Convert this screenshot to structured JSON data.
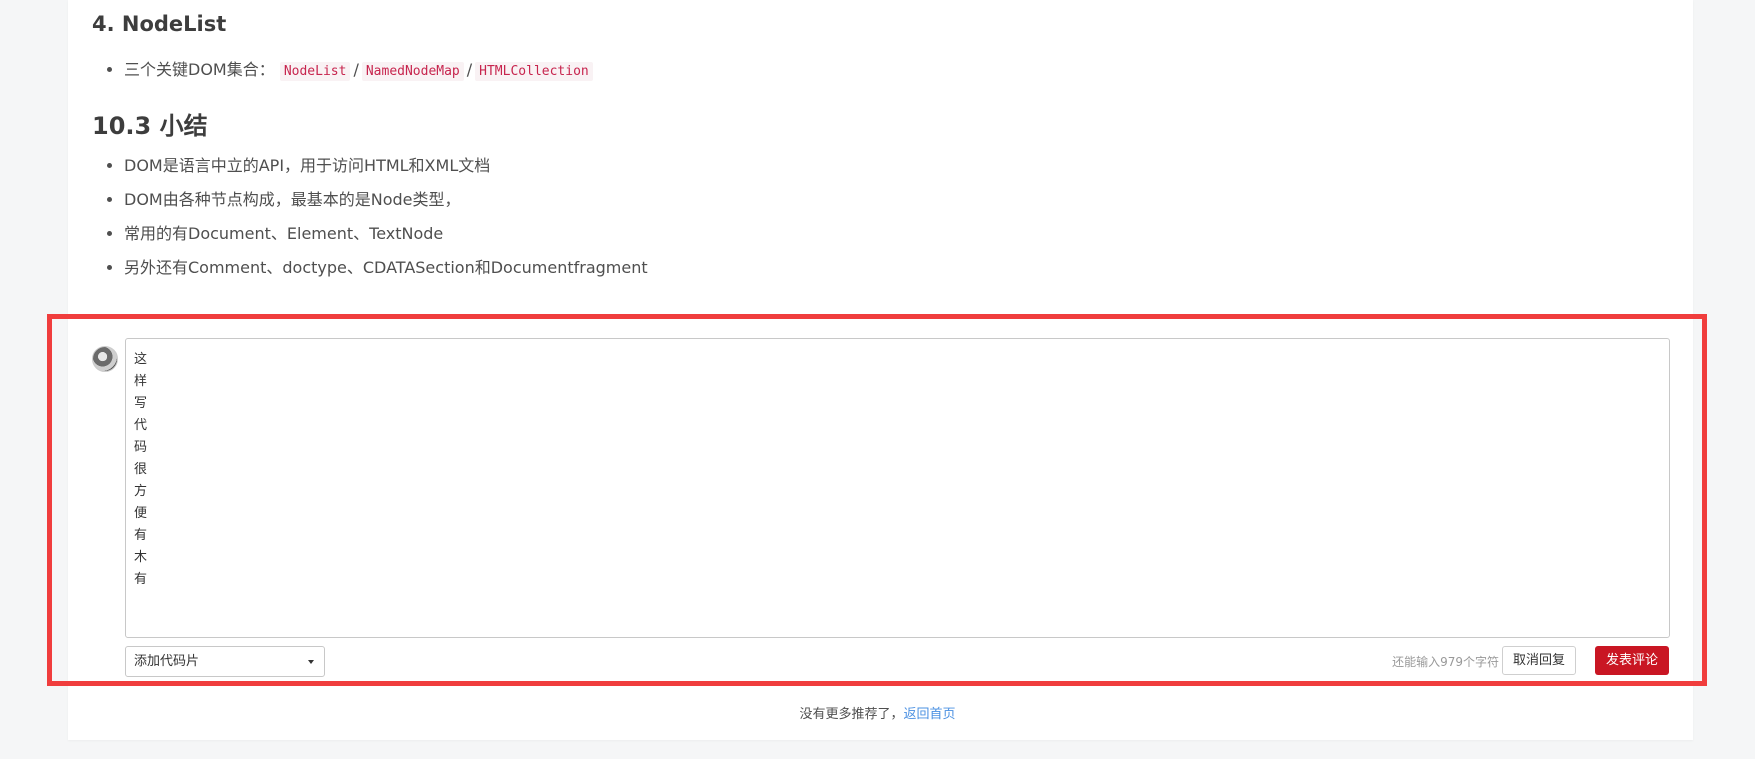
{
  "article": {
    "section_nodelist": {
      "title": "4. NodeList",
      "bullet_prefix": "三个关键DOM集合：",
      "codes": [
        "NodeList",
        "NamedNodeMap",
        "HTMLCollection"
      ],
      "separator": "/"
    },
    "section_summary": {
      "title": "10.3 小结",
      "bullets": [
        "DOM是语言中立的API，用于访问HTML和XML文档",
        "DOM由各种节点构成，最基本的是Node类型，",
        "常用的有Document、Element、TextNode",
        "另外还有Comment、doctype、CDATASection和Documentfragment"
      ]
    }
  },
  "comment": {
    "textarea_value": "这样写代码很方便有木有",
    "code_snippet_select": "添加代码片",
    "char_count": "还能输入979个字符",
    "cancel_label": "取消回复",
    "submit_label": "发表评论"
  },
  "footer": {
    "text": "没有更多推荐了，",
    "link": "返回首页"
  },
  "colors": {
    "highlight_border": "#f03d3d",
    "submit_bg": "#c91623",
    "code_text": "#c7254e",
    "link": "#4a90e2"
  }
}
